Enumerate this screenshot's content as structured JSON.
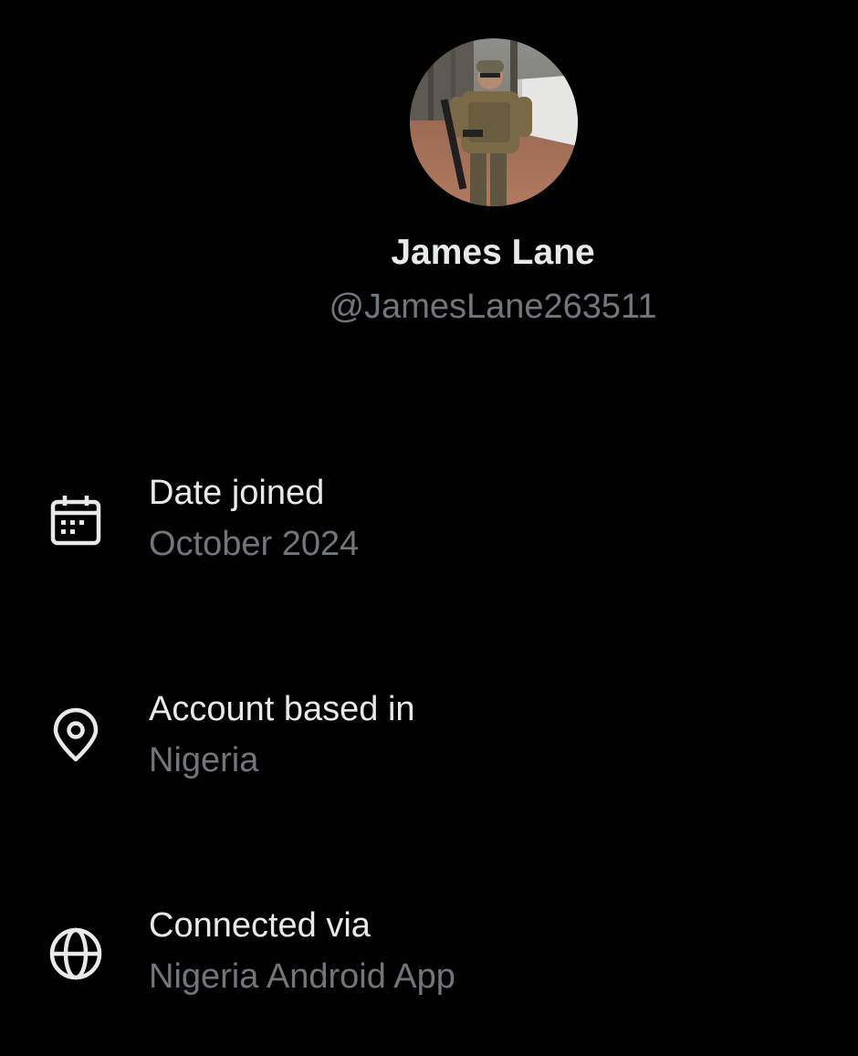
{
  "profile": {
    "display_name": "James Lane",
    "handle": "@JamesLane263511",
    "avatar_icon": "profile-photo-avatar"
  },
  "about": {
    "date_joined": {
      "icon": "calendar-icon",
      "label": "Date joined",
      "value": "October 2024"
    },
    "based_in": {
      "icon": "location-pin-icon",
      "label": "Account based in",
      "value": "Nigeria"
    },
    "connected_via": {
      "icon": "globe-icon",
      "label": "Connected via",
      "value": "Nigeria Android App"
    }
  },
  "colors": {
    "background": "#000000",
    "primary_text": "#e7e9ea",
    "secondary_text": "#71767b"
  }
}
